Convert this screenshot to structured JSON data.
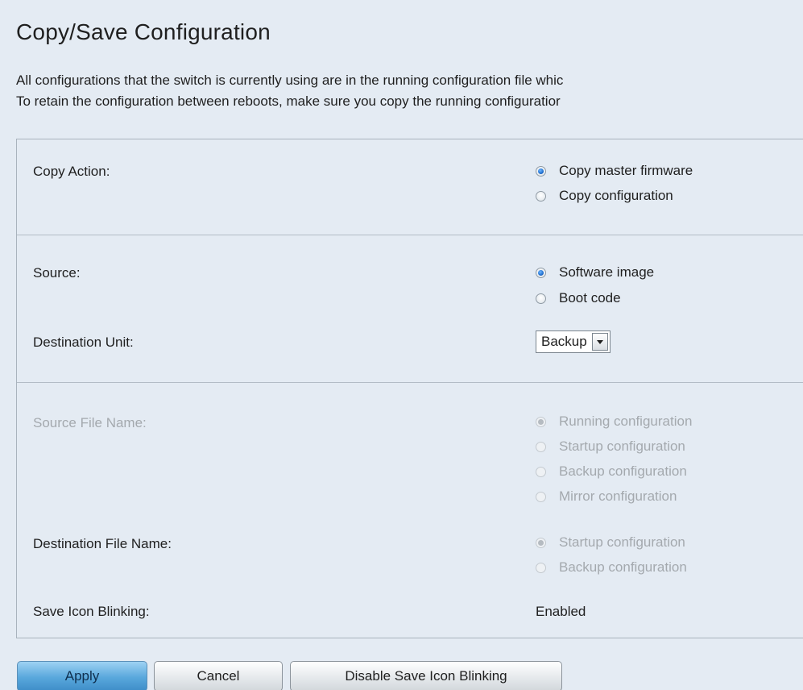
{
  "page": {
    "title": "Copy/Save Configuration",
    "description_line1": "All configurations that the switch is currently using are in the running configuration file whic",
    "description_line2": "To retain the configuration between reboots, make sure you copy the running configuratior"
  },
  "form": {
    "copy_action": {
      "label": "Copy Action:",
      "options": [
        {
          "label": "Copy master firmware",
          "checked": true,
          "enabled": true
        },
        {
          "label": "Copy configuration",
          "checked": false,
          "enabled": true
        }
      ]
    },
    "source": {
      "label": "Source:",
      "options": [
        {
          "label": "Software image",
          "checked": true,
          "enabled": true
        },
        {
          "label": "Boot code",
          "checked": false,
          "enabled": true
        }
      ]
    },
    "destination_unit": {
      "label": "Destination Unit:",
      "selected": "Backup"
    },
    "source_file_name": {
      "label": "Source File Name:",
      "enabled": false,
      "options": [
        {
          "label": "Running configuration",
          "checked": true,
          "enabled": false
        },
        {
          "label": "Startup configuration",
          "checked": false,
          "enabled": false
        },
        {
          "label": "Backup configuration",
          "checked": false,
          "enabled": false
        },
        {
          "label": "Mirror configuration",
          "checked": false,
          "enabled": false
        }
      ]
    },
    "destination_file_name": {
      "label": "Destination File Name:",
      "options": [
        {
          "label": "Startup configuration",
          "checked": true,
          "enabled": false
        },
        {
          "label": "Backup configuration",
          "checked": false,
          "enabled": false
        }
      ]
    },
    "save_icon_blinking": {
      "label": "Save Icon Blinking:",
      "value": "Enabled"
    }
  },
  "buttons": {
    "apply": "Apply",
    "cancel": "Cancel",
    "disable_blinking": "Disable Save Icon Blinking"
  }
}
